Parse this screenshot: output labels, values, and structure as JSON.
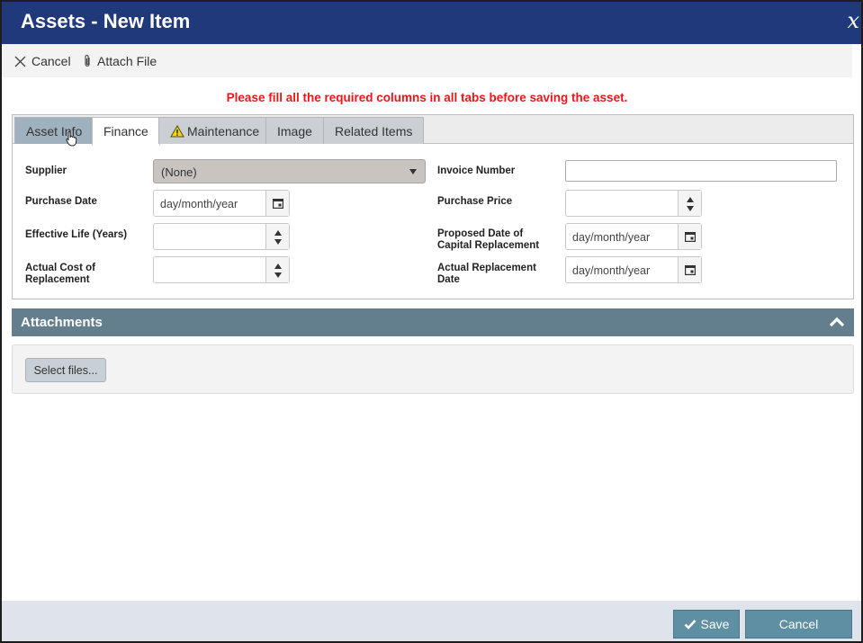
{
  "window": {
    "title": "Assets - New Item",
    "close_glyph": "x"
  },
  "toolbar": {
    "cancel_label": "Cancel",
    "attach_label": "Attach File"
  },
  "warning_message": "Please fill all the required columns in all tabs before saving the asset.",
  "tabs": [
    {
      "label": "Asset Info",
      "state": "hover"
    },
    {
      "label": "Finance",
      "state": "active"
    },
    {
      "label": "Maintenance",
      "state": "normal",
      "icon": "warning-icon"
    },
    {
      "label": "Image",
      "state": "normal"
    },
    {
      "label": "Related Items",
      "state": "normal"
    }
  ],
  "form": {
    "supplier": {
      "label": "Supplier",
      "value": "(None)"
    },
    "invoice_number": {
      "label": "Invoice Number",
      "value": ""
    },
    "purchase_date": {
      "label": "Purchase Date",
      "value": "day/month/year"
    },
    "purchase_price": {
      "label": "Purchase Price",
      "value": ""
    },
    "effective_life": {
      "label": "Effective Life (Years)",
      "value": ""
    },
    "proposed_date": {
      "label_line1": "Proposed Date of",
      "label_line2": "Capital Replacement",
      "value": "day/month/year"
    },
    "actual_cost": {
      "label_line1": "Actual Cost of",
      "label_line2": "Replacement",
      "value": ""
    },
    "actual_replacement_date": {
      "label_line1": "Actual Replacement",
      "label_line2": "Date",
      "value": "day/month/year"
    }
  },
  "attachments": {
    "title": "Attachments",
    "select_files_label": "Select files..."
  },
  "footer": {
    "save_label": "Save",
    "cancel_label": "Cancel"
  },
  "colors": {
    "title_bar": "#20397a",
    "warning_text": "#e61919",
    "section_header": "#637f8e",
    "button": "#5e8fa3",
    "footer_bg": "#dfe4ec"
  }
}
